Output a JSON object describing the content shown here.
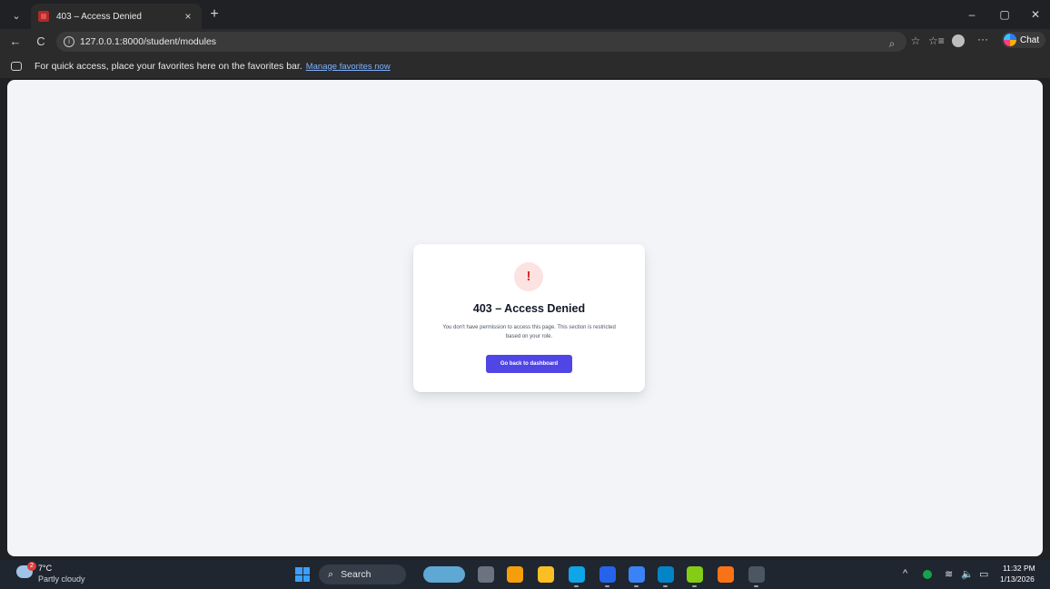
{
  "browser": {
    "tab": {
      "title": "403 – Access Denied",
      "close_glyph": "×"
    },
    "new_tab_glyph": "+",
    "tab_menu_glyph": "⌄",
    "window_controls": {
      "minimize": "–",
      "restore": "▢",
      "close": "✕"
    },
    "nav": {
      "back_glyph": "←",
      "refresh_glyph": "C",
      "info_glyph": "i"
    },
    "url": "127.0.0.1:8000/student/modules",
    "omnibox_icons": {
      "zoom": "⌕",
      "favorite": "☆",
      "favorites_list": "☆≡"
    },
    "more_glyph": "···",
    "chat_label": "Chat",
    "favorites_bar": {
      "message": "For quick access, place your favorites here on the favorites bar.",
      "link": "Manage favorites now"
    }
  },
  "page": {
    "icon_glyph": "!",
    "title": "403 – Access Denied",
    "message": "You don't have permission to access this page. This section is restricted based on your role.",
    "button": "Go back to dashboard"
  },
  "colors": {
    "accent": "#4f46e5",
    "error": "#dc2626",
    "error_bg": "#fde2e2",
    "page_bg": "#f2f4f8"
  },
  "taskbar": {
    "weather": {
      "temp": "7°C",
      "condition": "Partly cloudy",
      "badge": "2"
    },
    "search_label": "Search",
    "search_glyph": "⌕",
    "apps": [
      {
        "name": "widgets-icon",
        "color": "#5fa8d3"
      },
      {
        "name": "file-explorer-app-icon",
        "color": "#6b7280"
      },
      {
        "name": "chrome-icon",
        "color": "#f59e0b"
      },
      {
        "name": "folder-icon",
        "color": "#fbbf24"
      },
      {
        "name": "edge-icon",
        "color": "#0ea5e9"
      },
      {
        "name": "word-icon",
        "color": "#2563eb"
      },
      {
        "name": "vscode-icon",
        "color": "#3b82f6"
      },
      {
        "name": "app-icon",
        "color": "#0284c7"
      },
      {
        "name": "colorful-app-icon",
        "color": "#84cc16"
      },
      {
        "name": "xampp-icon",
        "color": "#f97316"
      },
      {
        "name": "terminal-icon",
        "color": "#4b5563"
      }
    ],
    "tray": {
      "chevron": "^",
      "wifi": "≋",
      "volume": "🔈",
      "battery": "▭"
    },
    "clock": {
      "time": "11:32 PM",
      "date": "1/13/2026"
    }
  }
}
